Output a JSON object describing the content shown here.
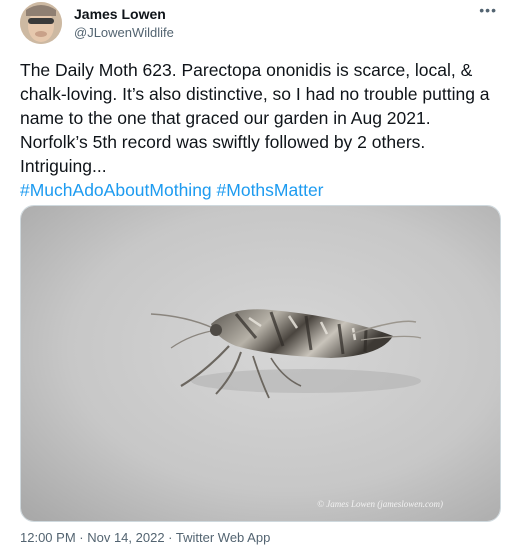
{
  "author": {
    "name": "James Lowen",
    "handle": "@JLowenWildlife"
  },
  "menu_icon": "more-horizontal-icon",
  "tweet": {
    "text": "The Daily Moth 623. Parectopa ononidis is scarce, local, & chalk-loving. It’s also distinctive, so I had no trouble putting a name to the one that graced our garden in Aug 2021. Norfolk’s 5th record was swiftly followed by 2 others. Intriguing...",
    "hashtags": [
      "#MuchAdoAboutMothing",
      "#MothsMatter"
    ]
  },
  "media": {
    "watermark": "© James Lowen (jameslowen.com)"
  },
  "meta": {
    "time": "12:00 PM",
    "date": "Nov 14, 2022",
    "source": "Twitter Web App",
    "separator": " · "
  },
  "colors": {
    "accent": "#1d9bf0",
    "secondary_text": "#536471"
  }
}
